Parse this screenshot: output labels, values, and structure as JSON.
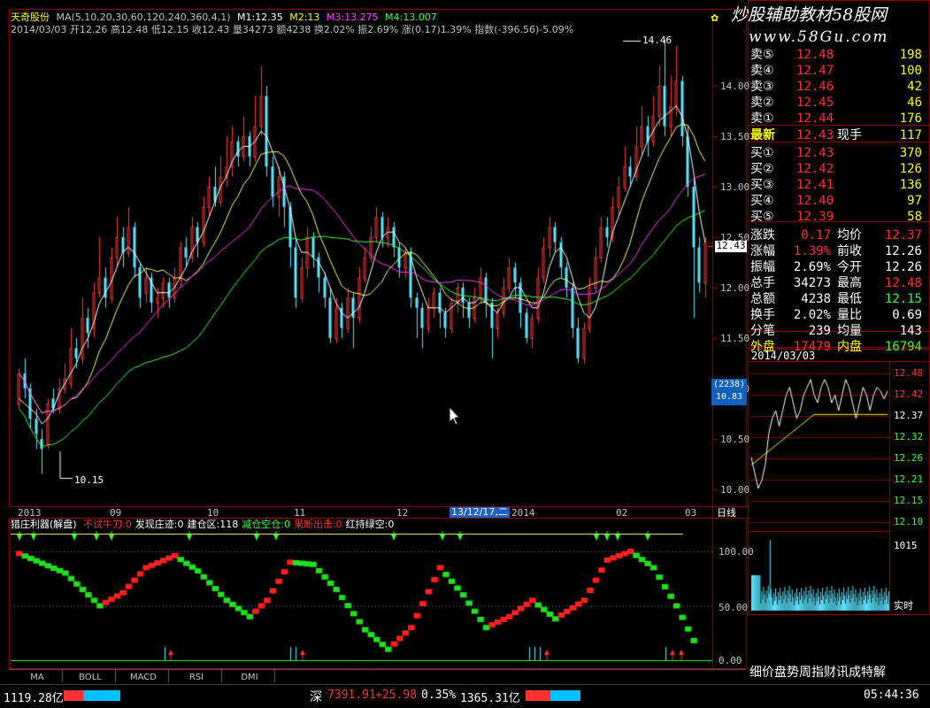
{
  "header": {
    "stock_name": "天奇股份",
    "ma_params": "MA(5,10,20,30,60,120,240,360,4,1)",
    "m1": "M1:12.35",
    "m2": "M2:13",
    "m3": "M3:13.275",
    "m4": "M4:13.007",
    "bar_info": "2014/03/03  开12.26  高12.48  低12.15  收12.43  量34273  额4238  换2.02%  振2.69%  涨(0.17)1.39%  指数(-396.56)-5.09%",
    "watermark_top": "炒股辅助教材58股网",
    "watermark_url": "www.58Gu.com",
    "pin_icon": "pin-icon"
  },
  "price_axis": {
    "ticks": [
      "14.00",
      "13.50",
      "13.00",
      "12.50",
      "12.00",
      "11.50",
      "11.00",
      "10.50",
      "10.00"
    ],
    "current_price": "12.43",
    "cursor_box": [
      "(2238)",
      "10.83"
    ]
  },
  "annotations": {
    "high": "14.46",
    "low": "10.15"
  },
  "date_axis": {
    "labels": [
      "2013",
      "09",
      "10",
      "11",
      "12",
      "2014",
      "02",
      "03"
    ],
    "cursor_date": "13/12/17,二",
    "period": "日线"
  },
  "indicator": {
    "title": "猎庄利器(解盘)",
    "items": [
      {
        "label": "不试牛刀:0",
        "color": "#ff3030"
      },
      {
        "label": "发现庄迹:0",
        "color": "#ffffff"
      },
      {
        "label": "建仓区:118",
        "color": "#ffffff"
      },
      {
        "label": "减仓空仓:0",
        "color": "#30ff30"
      },
      {
        "label": "果断出击:0",
        "color": "#ff3030"
      },
      {
        "label": "红持绿空:0",
        "color": "#ffffff"
      }
    ],
    "axis": [
      "100.00",
      "50.00",
      "0.00"
    ]
  },
  "tabs": [
    "MA",
    "BOLL",
    "MACD",
    "RSI",
    "DMI"
  ],
  "order_book": {
    "sells": [
      {
        "label": "卖⑤",
        "price": "12.48",
        "vol": "198"
      },
      {
        "label": "卖④",
        "price": "12.47",
        "vol": "100"
      },
      {
        "label": "卖③",
        "price": "12.46",
        "vol": "42"
      },
      {
        "label": "卖②",
        "price": "12.45",
        "vol": "46"
      },
      {
        "label": "卖①",
        "price": "12.44",
        "vol": "176"
      }
    ],
    "latest": {
      "label": "最新",
      "price": "12.43",
      "label2": "现手",
      "vol": "117"
    },
    "buys": [
      {
        "label": "买①",
        "price": "12.43",
        "vol": "370"
      },
      {
        "label": "买②",
        "price": "12.42",
        "vol": "126"
      },
      {
        "label": "买③",
        "price": "12.41",
        "vol": "136"
      },
      {
        "label": "买④",
        "price": "12.40",
        "vol": "97"
      },
      {
        "label": "买⑤",
        "price": "12.39",
        "vol": "58"
      }
    ],
    "stats": [
      {
        "l1": "涨跌",
        "v1": "0.17",
        "c1": "#ff3030",
        "l2": "均价",
        "v2": "12.37",
        "c2": "#ff3030"
      },
      {
        "l1": "涨幅",
        "v1": "1.39%",
        "c1": "#ff3030",
        "l2": "前收",
        "v2": "12.26",
        "c2": "#ffffff"
      },
      {
        "l1": "振幅",
        "v1": "2.69%",
        "c1": "#ffffff",
        "l2": "今开",
        "v2": "12.26",
        "c2": "#ffffff"
      },
      {
        "l1": "总手",
        "v1": "34273",
        "c1": "#ffffff",
        "l2": "最高",
        "v2": "12.48",
        "c2": "#ff3030"
      },
      {
        "l1": "总额",
        "v1": "4238",
        "c1": "#ffffff",
        "l2": "最低",
        "v2": "12.15",
        "c2": "#30ff30"
      },
      {
        "l1": "换手",
        "v1": "2.02%",
        "c1": "#ffffff",
        "l2": "量比",
        "v2": "0.69",
        "c2": "#ffffff"
      },
      {
        "l1": "分笔",
        "v1": "239",
        "c1": "#ffffff",
        "l2": "均量",
        "v2": "143",
        "c2": "#ffffff"
      }
    ],
    "outer": {
      "label": "外盘",
      "value": "17479",
      "label2": "内盘",
      "value2": "16794"
    }
  },
  "intraday": {
    "date": "2014/03/03",
    "price_axis": [
      "12.48",
      "12.42",
      "12.37",
      "12.32",
      "12.26",
      "12.21",
      "12.15",
      "12.10"
    ],
    "vol_axis": "1015",
    "mode": "实时"
  },
  "side_footer": "细价盘势周指财讯成特解",
  "statusbar": {
    "left_value": "1119.28亿",
    "market": "深",
    "index": "7391.91",
    "change": "+25.98",
    "pct": "0.35%",
    "amount": "1365.31亿",
    "time": "05:44:36"
  },
  "colors": {
    "up": "#ff3b3b",
    "down": "#5ce6ff",
    "ma5": "#ffffff",
    "ma10": "#ffff80",
    "ma20": "#ff40ff",
    "ma30": "#40ff40",
    "frame": "#a00000"
  },
  "candles": [
    [
      10.85,
      11.15,
      11.2,
      10.8
    ],
    [
      11.15,
      11.0,
      11.3,
      10.9
    ],
    [
      11.0,
      10.7,
      11.05,
      10.6
    ],
    [
      10.7,
      10.55,
      10.8,
      10.4
    ],
    [
      10.5,
      10.4,
      10.6,
      10.15
    ],
    [
      10.45,
      10.85,
      10.9,
      10.4
    ],
    [
      10.9,
      10.8,
      11.0,
      10.75
    ],
    [
      10.8,
      11.0,
      11.1,
      10.75
    ],
    [
      11.0,
      11.1,
      11.25,
      10.95
    ],
    [
      11.05,
      11.4,
      11.6,
      11.0
    ],
    [
      11.4,
      11.3,
      11.5,
      11.2
    ],
    [
      11.3,
      11.7,
      11.9,
      11.25
    ],
    [
      11.7,
      11.55,
      11.8,
      11.4
    ],
    [
      11.6,
      11.95,
      12.05,
      11.5
    ],
    [
      11.95,
      12.1,
      12.5,
      11.9
    ],
    [
      12.1,
      11.9,
      12.2,
      11.8
    ],
    [
      11.9,
      12.3,
      12.4,
      11.85
    ],
    [
      12.3,
      12.5,
      12.7,
      12.2
    ],
    [
      12.5,
      12.35,
      12.6,
      12.2
    ],
    [
      12.35,
      12.6,
      12.8,
      12.3
    ],
    [
      12.6,
      12.2,
      12.65,
      12.1
    ],
    [
      12.2,
      11.9,
      12.25,
      11.8
    ],
    [
      11.95,
      12.1,
      12.2,
      11.85
    ],
    [
      12.1,
      11.85,
      12.15,
      11.75
    ],
    [
      11.85,
      11.9,
      12.0,
      11.7
    ],
    [
      11.9,
      12.05,
      12.1,
      11.8
    ],
    [
      12.05,
      11.9,
      12.1,
      11.8
    ],
    [
      11.9,
      12.1,
      12.2,
      11.85
    ],
    [
      12.1,
      12.4,
      12.45,
      12.0
    ],
    [
      12.4,
      12.3,
      12.5,
      12.2
    ],
    [
      12.3,
      12.6,
      12.7,
      12.25
    ],
    [
      12.6,
      12.45,
      12.65,
      12.3
    ],
    [
      12.45,
      12.8,
      12.9,
      12.4
    ],
    [
      12.8,
      13.0,
      13.1,
      12.7
    ],
    [
      13.0,
      12.85,
      13.2,
      12.8
    ],
    [
      12.85,
      13.1,
      13.3,
      12.8
    ],
    [
      13.1,
      13.2,
      13.5,
      13.0
    ],
    [
      13.2,
      13.45,
      13.6,
      13.1
    ],
    [
      13.45,
      13.3,
      13.5,
      13.2
    ],
    [
      13.3,
      13.5,
      13.7,
      13.25
    ],
    [
      13.5,
      13.3,
      13.55,
      13.2
    ],
    [
      13.3,
      13.6,
      13.9,
      13.25
    ],
    [
      13.6,
      13.9,
      14.2,
      13.5
    ],
    [
      13.9,
      13.2,
      14.0,
      13.1
    ],
    [
      13.2,
      12.9,
      13.3,
      12.8
    ],
    [
      12.9,
      13.1,
      13.2,
      12.7
    ],
    [
      13.1,
      12.8,
      13.15,
      12.6
    ],
    [
      12.8,
      12.4,
      12.85,
      12.2
    ],
    [
      12.4,
      11.9,
      12.5,
      11.8
    ],
    [
      11.9,
      12.2,
      12.3,
      11.85
    ],
    [
      12.2,
      12.5,
      12.6,
      12.1
    ],
    [
      12.5,
      12.3,
      12.55,
      12.2
    ],
    [
      12.3,
      12.1,
      12.35,
      11.95
    ],
    [
      12.1,
      11.9,
      12.15,
      11.8
    ],
    [
      11.9,
      11.5,
      12.0,
      11.45
    ],
    [
      11.5,
      11.8,
      11.9,
      11.45
    ],
    [
      11.8,
      11.6,
      11.85,
      11.5
    ],
    [
      11.6,
      11.9,
      12.0,
      11.55
    ],
    [
      11.9,
      11.7,
      11.95,
      11.4
    ],
    [
      11.7,
      12.1,
      12.2,
      11.65
    ],
    [
      12.1,
      12.3,
      12.4,
      12.05
    ],
    [
      12.3,
      12.5,
      12.6,
      12.25
    ],
    [
      12.5,
      12.7,
      12.8,
      12.45
    ],
    [
      12.7,
      12.5,
      12.75,
      12.4
    ],
    [
      12.5,
      12.6,
      12.7,
      12.4
    ],
    [
      12.6,
      12.4,
      12.65,
      12.3
    ],
    [
      12.4,
      12.2,
      12.45,
      12.1
    ],
    [
      12.2,
      12.35,
      12.4,
      12.1
    ],
    [
      12.35,
      11.9,
      12.4,
      11.8
    ],
    [
      11.9,
      11.8,
      11.95,
      11.5
    ],
    [
      11.8,
      11.6,
      11.85,
      11.4
    ],
    [
      11.6,
      11.8,
      11.9,
      11.55
    ],
    [
      11.8,
      11.95,
      12.0,
      11.7
    ],
    [
      11.95,
      11.75,
      12.0,
      11.6
    ],
    [
      11.75,
      11.6,
      11.8,
      11.5
    ],
    [
      11.6,
      11.85,
      11.9,
      11.55
    ],
    [
      11.85,
      12.0,
      12.05,
      11.75
    ],
    [
      12.0,
      11.85,
      12.05,
      11.7
    ],
    [
      11.85,
      11.7,
      11.9,
      11.6
    ],
    [
      11.7,
      11.9,
      12.0,
      11.65
    ],
    [
      11.9,
      12.1,
      12.2,
      11.85
    ],
    [
      12.1,
      11.85,
      12.15,
      11.7
    ],
    [
      11.85,
      11.6,
      11.9,
      11.3
    ],
    [
      11.6,
      11.75,
      11.8,
      11.5
    ],
    [
      11.75,
      12.0,
      12.1,
      11.7
    ],
    [
      12.0,
      12.2,
      12.3,
      11.95
    ],
    [
      12.2,
      12.05,
      12.25,
      11.9
    ],
    [
      12.05,
      11.75,
      12.1,
      11.6
    ],
    [
      11.75,
      11.5,
      11.8,
      11.45
    ],
    [
      11.5,
      11.7,
      11.75,
      11.4
    ],
    [
      11.7,
      12.1,
      12.2,
      11.65
    ],
    [
      12.1,
      12.4,
      12.5,
      12.05
    ],
    [
      12.4,
      12.6,
      12.7,
      12.3
    ],
    [
      12.6,
      12.45,
      12.65,
      12.35
    ],
    [
      12.45,
      12.2,
      12.5,
      12.1
    ],
    [
      12.2,
      12.0,
      12.25,
      11.9
    ],
    [
      12.0,
      11.6,
      12.05,
      11.5
    ],
    [
      11.6,
      11.3,
      11.7,
      11.25
    ],
    [
      11.3,
      11.6,
      11.65,
      11.25
    ],
    [
      11.6,
      12.0,
      12.1,
      11.55
    ],
    [
      12.0,
      12.3,
      12.4,
      11.95
    ],
    [
      12.3,
      12.6,
      12.7,
      12.25
    ],
    [
      12.6,
      12.5,
      12.7,
      12.4
    ],
    [
      12.5,
      12.8,
      12.9,
      12.45
    ],
    [
      12.8,
      13.0,
      13.1,
      12.7
    ],
    [
      13.0,
      13.2,
      13.4,
      12.95
    ],
    [
      13.2,
      13.1,
      13.3,
      13.0
    ],
    [
      13.1,
      13.4,
      13.6,
      13.05
    ],
    [
      13.4,
      13.6,
      13.8,
      13.3
    ],
    [
      13.6,
      13.45,
      13.7,
      13.3
    ],
    [
      13.45,
      13.7,
      13.9,
      13.4
    ],
    [
      13.7,
      14.0,
      14.2,
      13.6
    ],
    [
      14.0,
      13.6,
      14.46,
      13.5
    ],
    [
      13.6,
      13.8,
      14.1,
      13.5
    ],
    [
      13.8,
      14.05,
      14.4,
      13.7
    ],
    [
      14.05,
      13.5,
      14.1,
      13.4
    ],
    [
      13.5,
      13.0,
      13.6,
      12.9
    ],
    [
      13.0,
      12.4,
      13.1,
      11.7
    ],
    [
      12.4,
      12.05,
      12.5,
      11.95
    ],
    [
      12.05,
      12.45,
      12.5,
      11.9
    ]
  ],
  "ma5": [
    10.9,
    10.85,
    10.8,
    10.75,
    10.65,
    10.7,
    10.8,
    10.95,
    11.05,
    11.15,
    11.25,
    11.4,
    11.5,
    11.65,
    11.85,
    11.95,
    12.05,
    12.2,
    12.35,
    12.4,
    12.35,
    12.25,
    12.15,
    12.05,
    11.95,
    11.95,
    11.95,
    12.0,
    12.1,
    12.2,
    12.35,
    12.45,
    12.55,
    12.7,
    12.85,
    13.0,
    13.1,
    13.25,
    13.35,
    13.4,
    13.4,
    13.45,
    13.55,
    13.5,
    13.35,
    13.2,
    13.0,
    12.8,
    12.5,
    12.35,
    12.35,
    12.3,
    12.25,
    12.15,
    12.0,
    11.85,
    11.75,
    11.7,
    11.75,
    11.8,
    11.95,
    12.15,
    12.35,
    12.5,
    12.55,
    12.55,
    12.45,
    12.4,
    12.3,
    12.1,
    11.95,
    11.8,
    11.8,
    11.8,
    11.75,
    11.8,
    11.85,
    11.9,
    11.85,
    11.85,
    11.9,
    11.85,
    11.8,
    11.75,
    11.85,
    11.9,
    12.0,
    12.0,
    11.9,
    11.8,
    11.8,
    11.95,
    12.2,
    12.35,
    12.4,
    12.3,
    12.1,
    11.9,
    11.75,
    11.7,
    11.8,
    12.0,
    12.3,
    12.55,
    12.7,
    12.85,
    13.0,
    13.15,
    13.3,
    13.45,
    13.55,
    13.65,
    13.7,
    13.75,
    13.8,
    13.7,
    13.5,
    13.15,
    12.75,
    12.45
  ]
}
